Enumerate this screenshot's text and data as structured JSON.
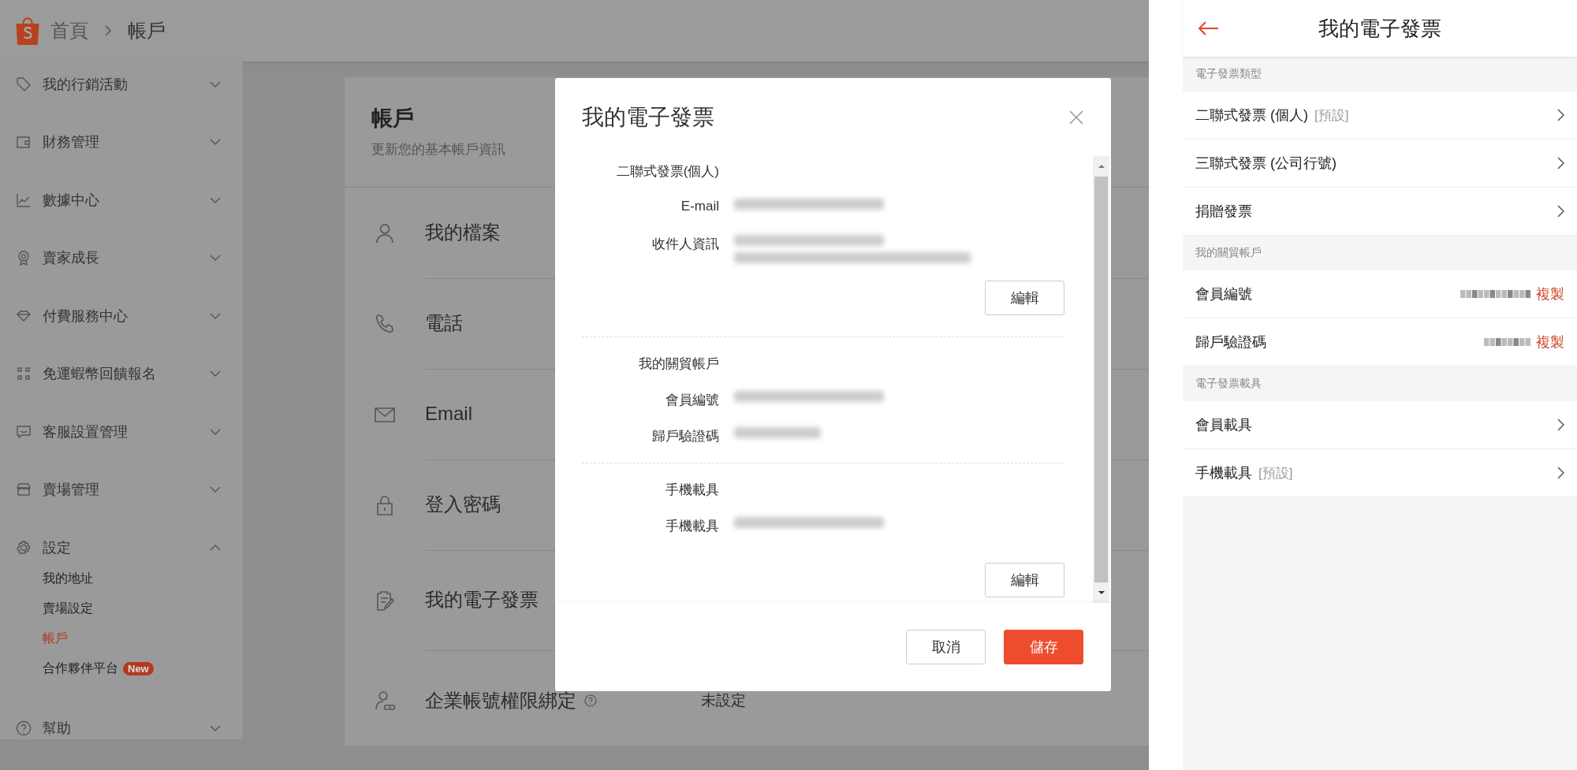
{
  "breadcrumb": {
    "home": "首頁",
    "current": "帳戶"
  },
  "sidebar": {
    "items": [
      {
        "label": "我的行銷活動",
        "expanded": false
      },
      {
        "label": "財務管理",
        "expanded": false
      },
      {
        "label": "數據中心",
        "expanded": false
      },
      {
        "label": "賣家成長",
        "expanded": false
      },
      {
        "label": "付費服務中心",
        "expanded": false
      },
      {
        "label": "免運蝦幣回饋報名",
        "expanded": false
      },
      {
        "label": "客服設置管理",
        "expanded": false
      },
      {
        "label": "賣場管理",
        "expanded": false
      },
      {
        "label": "設定",
        "expanded": true,
        "children": [
          {
            "label": "我的地址",
            "selected": false
          },
          {
            "label": "賣場設定",
            "selected": false
          },
          {
            "label": "帳戶",
            "selected": true
          },
          {
            "label": "合作夥伴平台",
            "selected": false,
            "badge": "New"
          }
        ]
      },
      {
        "label": "幫助",
        "expanded": false
      }
    ]
  },
  "account_card": {
    "title": "帳戶",
    "subtitle": "更新您的基本帳戶資訊",
    "rows": [
      {
        "label": "我的檔案",
        "help": false
      },
      {
        "label": "電話",
        "help": false
      },
      {
        "label": "Email",
        "help": false
      },
      {
        "label": "登入密碼",
        "help": false
      },
      {
        "label": "我的電子發票",
        "help": false
      },
      {
        "label": "企業帳號權限綁定",
        "help": true,
        "value": "未設定"
      }
    ]
  },
  "modal": {
    "title": "我的電子發票",
    "sections": [
      {
        "heading": "二聯式發票(個人)",
        "fields": [
          {
            "label": "E-mail",
            "kind": "single"
          },
          {
            "label": "收件人資訊",
            "kind": "multiline"
          }
        ],
        "action": "編輯"
      },
      {
        "heading": "我的關貿帳戶",
        "fields": [
          {
            "label": "會員編號",
            "kind": "single"
          },
          {
            "label": "歸戶驗證碼",
            "kind": "single"
          }
        ]
      },
      {
        "heading": "手機載具",
        "fields": [
          {
            "label": "手機載具",
            "kind": "single"
          }
        ],
        "action": "編輯"
      }
    ],
    "buttons": [
      {
        "label": "取消",
        "kind": "secondary"
      },
      {
        "label": "儲存",
        "kind": "primary"
      }
    ]
  },
  "mobile": {
    "title": "我的電子發票",
    "sections": [
      {
        "heading": "電子發票類型",
        "rows": [
          {
            "label": "二聯式發票 (個人)",
            "tag": "[預設]",
            "kind": "nav"
          },
          {
            "label": "三聯式發票 (公司行號)",
            "kind": "nav"
          },
          {
            "label": "捐贈發票",
            "kind": "nav"
          }
        ]
      },
      {
        "heading": "我的關貿帳戶",
        "rows": [
          {
            "label": "會員編號",
            "kind": "copy",
            "action": "複製"
          },
          {
            "label": "歸戶驗證碼",
            "kind": "copy",
            "action": "複製"
          }
        ]
      },
      {
        "heading": "電子發票載具",
        "rows": [
          {
            "label": "會員載具",
            "kind": "nav"
          },
          {
            "label": "手機載具",
            "tag": "[預設]",
            "kind": "nav"
          }
        ]
      }
    ]
  }
}
